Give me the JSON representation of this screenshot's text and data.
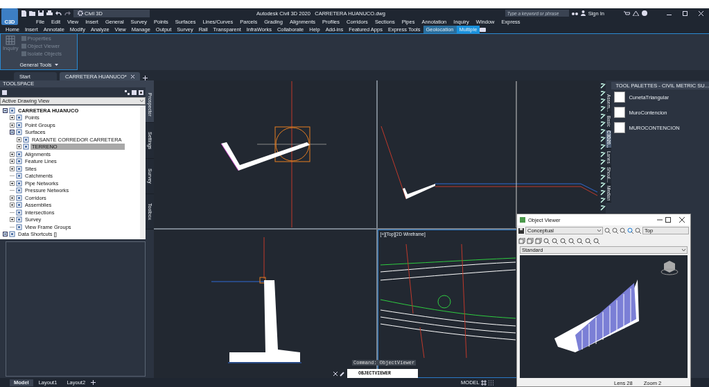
{
  "title_bar": {
    "logo": "C3D",
    "workspace": "Civil 3D",
    "title": "Autodesk Civil 3D 2020   CARRETERA HUANUCO.dwg",
    "search": {
      "placeholder": "Type a keyword or phrase"
    },
    "sign_in": "Sign In"
  },
  "menu_bar": [
    "File",
    "Edit",
    "View",
    "Insert",
    "General",
    "Survey",
    "Points",
    "Surfaces",
    "Lines/Curves",
    "Parcels",
    "Grading",
    "Alignments",
    "Profiles",
    "Corridors",
    "Sections",
    "Pipes",
    "Annotation",
    "Inquiry",
    "Window",
    "Express"
  ],
  "ribbon_tabs": [
    {
      "label": "Home",
      "kind": "normal",
      "selected": false
    },
    {
      "label": "Insert",
      "kind": "normal",
      "selected": false
    },
    {
      "label": "Annotate",
      "kind": "normal",
      "selected": false
    },
    {
      "label": "Modify",
      "kind": "normal",
      "selected": false
    },
    {
      "label": "Analyze",
      "kind": "normal",
      "selected": false
    },
    {
      "label": "View",
      "kind": "normal",
      "selected": false
    },
    {
      "label": "Manage",
      "kind": "normal",
      "selected": false
    },
    {
      "label": "Output",
      "kind": "normal",
      "selected": false
    },
    {
      "label": "Survey",
      "kind": "normal",
      "selected": false
    },
    {
      "label": "Rail",
      "kind": "normal",
      "selected": false
    },
    {
      "label": "Transparent",
      "kind": "normal",
      "selected": false
    },
    {
      "label": "InfraWorks",
      "kind": "normal",
      "selected": false
    },
    {
      "label": "Collaborate",
      "kind": "normal",
      "selected": false
    },
    {
      "label": "Help",
      "kind": "normal",
      "selected": false
    },
    {
      "label": "Add-ins",
      "kind": "normal",
      "selected": false
    },
    {
      "label": "Featured Apps",
      "kind": "normal",
      "selected": false
    },
    {
      "label": "Express Tools",
      "kind": "normal",
      "selected": false
    },
    {
      "label": "Geolocation",
      "kind": "contextual",
      "selected": false
    },
    {
      "label": "Multiple",
      "kind": "contextual",
      "selected": true
    }
  ],
  "ribbon_panel": {
    "big_tool": {
      "label": "Inquiry",
      "disabled": true
    },
    "tools": [
      {
        "label": "Properties",
        "disabled": true
      },
      {
        "label": "Object Viewer",
        "disabled": true
      },
      {
        "label": "Isolate Objects",
        "disabled": true
      }
    ],
    "title": "General Tools"
  },
  "file_tabs": [
    {
      "label": "Start",
      "selected": false
    },
    {
      "label": "CARRETERA HUANUCO*",
      "selected": true
    }
  ],
  "toolspace": {
    "title": "TOOLSPACE",
    "view": "Active Drawing View",
    "tree": [
      {
        "label": "CARRETERA HUANUCO",
        "kind": "branch",
        "expanded": true,
        "selected": false,
        "children": [
          {
            "label": "Points",
            "kind": "branch",
            "expanded": false,
            "selected": false
          },
          {
            "label": "Point Groups",
            "kind": "branch",
            "expanded": false,
            "selected": false
          },
          {
            "label": "Surfaces",
            "kind": "branch",
            "expanded": true,
            "selected": false,
            "children": [
              {
                "label": "RASANTE CORREDOR CARRETERA",
                "kind": "branch",
                "expanded": false,
                "selected": false
              },
              {
                "label": "TERRENO",
                "kind": "branch",
                "expanded": false,
                "selected": true
              }
            ]
          },
          {
            "label": "Alignments",
            "kind": "branch",
            "expanded": false,
            "selected": false
          },
          {
            "label": "Feature Lines",
            "kind": "branch",
            "expanded": false,
            "selected": false
          },
          {
            "label": "Sites",
            "kind": "branch",
            "expanded": false,
            "selected": false
          },
          {
            "label": "Catchments",
            "kind": "leaf",
            "selected": false
          },
          {
            "label": "Pipe Networks",
            "kind": "branch",
            "expanded": false,
            "selected": false
          },
          {
            "label": "Pressure Networks",
            "kind": "leaf",
            "selected": false
          },
          {
            "label": "Corridors",
            "kind": "branch",
            "expanded": false,
            "selected": false
          },
          {
            "label": "Assemblies",
            "kind": "branch",
            "expanded": false,
            "selected": false
          },
          {
            "label": "Intersections",
            "kind": "leaf",
            "selected": false
          },
          {
            "label": "Survey",
            "kind": "branch",
            "expanded": false,
            "selected": false
          },
          {
            "label": "View Frame Groups",
            "kind": "leaf",
            "selected": false
          }
        ]
      },
      {
        "label": "Data Shortcuts []",
        "kind": "branch",
        "expanded": true,
        "selected": false
      }
    ],
    "tabs": [
      {
        "label": "Prospector",
        "selected": true
      },
      {
        "label": "Settings",
        "selected": false
      },
      {
        "label": "Survey",
        "selected": false
      },
      {
        "label": "Toolbox",
        "selected": false
      }
    ]
  },
  "viewports": [
    {
      "kind": "section",
      "selected": false
    },
    {
      "kind": "profile",
      "selected": false
    },
    {
      "kind": "wall",
      "selected": false
    },
    {
      "kind": "plan",
      "selected": true,
      "label": "[+][Top][2D Wireframe]"
    }
  ],
  "tool_palettes": {
    "title": "TOOL PALETTES - CIVIL METRIC SU...",
    "tabs": [
      {
        "label": "Assem...",
        "selected": false
      },
      {
        "label": "Basic",
        "selected": false
      },
      {
        "label": "C3D20...",
        "selected": true
      },
      {
        "label": "Lanes",
        "selected": false
      },
      {
        "label": "Shoul...",
        "selected": false
      },
      {
        "label": "Median",
        "selected": false
      }
    ],
    "items": [
      "CunetaTriangular",
      "MuroContencion",
      "MUROCONTENCION"
    ]
  },
  "object_viewer": {
    "title": "Object Viewer",
    "visual_style": "Conceptual",
    "view": "Top",
    "style": "Standard",
    "lens": "Lens 28",
    "zoom": "Zoom 2"
  },
  "command": {
    "history": "Command: ObjectViewer",
    "input": "OBJECTVIEWER"
  },
  "layout_tabs": [
    {
      "label": "Model",
      "selected": true
    },
    {
      "label": "Layout1",
      "selected": false
    },
    {
      "label": "Layout2",
      "selected": false
    }
  ],
  "status_bar": {
    "space": "MODEL"
  }
}
